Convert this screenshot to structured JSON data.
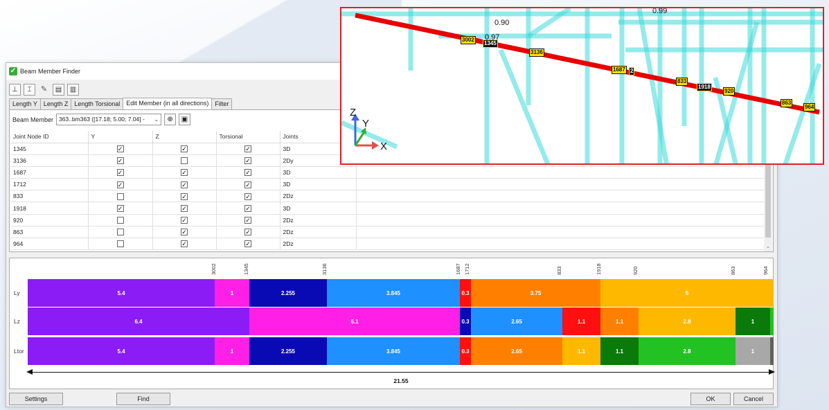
{
  "dialog": {
    "title": "Beam Member Finder",
    "tabs": [
      "Length Y",
      "Length Z",
      "Length Torsional",
      "Edit Member (in all directions)",
      "Filter"
    ],
    "member_label": "Beam Member",
    "member_value": "363..bm363 ([17.18; 5.00; 7.04] -",
    "columns": [
      "Joint Node ID",
      "Y",
      "Z",
      "Torsional",
      "Joints"
    ],
    "rows": [
      {
        "id": "1345",
        "y": true,
        "z": true,
        "t": true,
        "joints": "3D"
      },
      {
        "id": "3136",
        "y": true,
        "z": false,
        "t": true,
        "joints": "2Dy"
      },
      {
        "id": "1687",
        "y": true,
        "z": true,
        "t": true,
        "joints": "3D"
      },
      {
        "id": "1712",
        "y": true,
        "z": true,
        "t": true,
        "joints": "3D"
      },
      {
        "id": "833",
        "y": false,
        "z": true,
        "t": true,
        "joints": "2Dz"
      },
      {
        "id": "1918",
        "y": true,
        "z": true,
        "t": true,
        "joints": "3D"
      },
      {
        "id": "920",
        "y": false,
        "z": true,
        "t": true,
        "joints": "2Dz"
      },
      {
        "id": "863",
        "y": false,
        "z": true,
        "t": true,
        "joints": "2Dz"
      },
      {
        "id": "964",
        "y": false,
        "z": true,
        "t": true,
        "joints": "2Dz"
      }
    ],
    "buttons": {
      "settings": "Settings",
      "find": "Find",
      "ok": "OK",
      "cancel": "Cancel"
    }
  },
  "diagram": {
    "ticks": [
      "3002",
      "1345",
      "3136",
      "1687",
      "1712",
      "833",
      "1918",
      "920",
      "863",
      "964"
    ],
    "rows": [
      {
        "label": "Ly",
        "segments": [
          {
            "value": "5.4",
            "color": "#8b1cf5"
          },
          {
            "value": "1",
            "color": "#ff1fe6"
          },
          {
            "value": "2.255",
            "color": "#0a0ab4"
          },
          {
            "value": "3.845",
            "color": "#1e90ff"
          },
          {
            "value": "0.3",
            "color": "#ff1010"
          },
          {
            "value": "3.75",
            "color": "#ff8000"
          },
          {
            "value": "5",
            "color": "#ffb800"
          }
        ]
      },
      {
        "label": "Lz",
        "segments": [
          {
            "value": "6.4",
            "color": "#8b1cf5"
          },
          {
            "value": "6.1",
            "color": "#ff1fe6"
          },
          {
            "value": "0.3",
            "color": "#0a0ab4"
          },
          {
            "value": "2.65",
            "color": "#1e90ff"
          },
          {
            "value": "1.1",
            "color": "#ff1010"
          },
          {
            "value": "1.1",
            "color": "#ff8000"
          },
          {
            "value": "2.8",
            "color": "#ffb800"
          },
          {
            "value": "1",
            "color": "#0a7a0a"
          },
          {
            "value": "",
            "color": "#22c222"
          }
        ]
      },
      {
        "label": "Ltor",
        "segments": [
          {
            "value": "5.4",
            "color": "#8b1cf5"
          },
          {
            "value": "1",
            "color": "#ff1fe6"
          },
          {
            "value": "2.255",
            "color": "#0a0ab4"
          },
          {
            "value": "3.845",
            "color": "#1e90ff"
          },
          {
            "value": "0.3",
            "color": "#ff1010"
          },
          {
            "value": "2.65",
            "color": "#ff8000"
          },
          {
            "value": "1.1",
            "color": "#ffb800"
          },
          {
            "value": "1.1",
            "color": "#0a7a0a"
          },
          {
            "value": "2.8",
            "color": "#22c222"
          },
          {
            "value": "1",
            "color": "#a8a8a8"
          },
          {
            "value": "",
            "color": "#606060"
          }
        ]
      }
    ],
    "total": "21.55"
  },
  "view3d": {
    "labels": [
      "3002",
      "1345",
      "3136",
      "1687",
      "2",
      "833",
      "1918",
      "920",
      "863",
      "964"
    ],
    "values": [
      "0.90",
      "0.97",
      "0.99"
    ],
    "axes": {
      "z": "Z",
      "y": "Y",
      "x": "X"
    }
  }
}
